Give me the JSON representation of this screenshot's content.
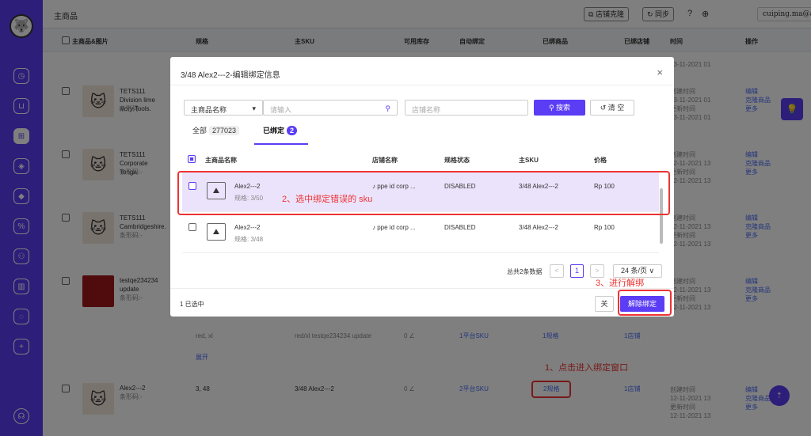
{
  "header": {
    "title": "主商品",
    "clone_label": "店铺克隆",
    "sync_label": "同步",
    "user": "cuiping.ma@a...∨"
  },
  "table": {
    "headers": [
      "主商品&图片",
      "规格",
      "主SKU",
      "可用库存",
      "自动绑定",
      "已绑商品",
      "已绑店铺",
      "时间",
      "操作"
    ],
    "rows": [
      {
        "title": "TETS111 Division lime ivory Tools.",
        "barcode": "条形码:-",
        "t1": "创建时间",
        "d1": "13-11-2021 01",
        "t2": "更新时间",
        "d2": "13-11-2021 01",
        "ops": [
          "编辑",
          "克隆商品",
          "更多"
        ]
      },
      {
        "title": "TETS111 Corporate Tonga",
        "barcode": "条形码:-",
        "t1": "创建时间",
        "d1": "12-11-2021 13",
        "t2": "更新时间",
        "d2": "12-11-2021 13",
        "ops": [
          "编辑",
          "克隆商品",
          "更多"
        ]
      },
      {
        "title": "TETS111 Cambridgeshire.",
        "barcode": "条形码:-",
        "t1": "创建时间",
        "d1": "12-11-2021 13",
        "t2": "更新时间",
        "d2": "12-11-2021 13",
        "ops": [
          "编辑",
          "克隆商品",
          "更多"
        ]
      },
      {
        "title": "testqe234234 update",
        "barcode": "条形码:-",
        "t1": "创建时间",
        "d1": "12-11-2021 13",
        "t2": "更新时间",
        "d2": "12-11-2021 13",
        "ops": [
          "编辑",
          "克隆商品",
          "更多"
        ]
      }
    ],
    "partial_top": {
      "d": "13-11-2021 01"
    },
    "sub_row": {
      "spec": "red, xl",
      "sku": "red/xl testqe234234 update",
      "stock": "0 ∠",
      "platform": "1平台SKU",
      "specs": "1规格",
      "stores": "1店铺"
    },
    "expand": "展开",
    "last_row": {
      "title": "Alex2---2",
      "barcode": "条形码:-",
      "spec": "3, 48",
      "sku": "3/48 Alex2---2",
      "stock": "0 ∠",
      "platform": "2平台SKU",
      "specs": "2规格",
      "stores": "1店铺",
      "t1": "创建时间",
      "d1": "12-11-2021 13",
      "t2": "更新时间",
      "d2": "12-11-2021 13",
      "ops": [
        "编辑",
        "克隆商品",
        "更多"
      ]
    }
  },
  "annotations": {
    "a1": "1、点击进入绑定窗口",
    "a2": "2、选中绑定错误的 sku",
    "a3": "3、进行解绑"
  },
  "modal": {
    "title": "3/48 Alex2---2-编辑绑定信息",
    "close": "×",
    "select_label": "主商品名称",
    "input_placeholder": "请输入",
    "store_placeholder": "店铺名称",
    "search_label": "搜索",
    "clear_label": "清 空",
    "tabs": [
      {
        "label": "全部",
        "count": "277023"
      },
      {
        "label": "已绑定",
        "count": "2"
      }
    ],
    "columns": [
      "主商品名称",
      "店铺名称",
      "规格状态",
      "主SKU",
      "价格"
    ],
    "rows": [
      {
        "name": "Alex2---2",
        "spec": "规格: 3/50",
        "store": "ppe id corp ...",
        "status": "DISABLED",
        "sku": "3/48 Alex2---2",
        "price": "Rp 100",
        "checked": true
      },
      {
        "name": "Alex2---2",
        "spec": "规格: 3/48",
        "store": "ppe id corp ...",
        "status": "DISABLED",
        "sku": "3/48 Alex2---2",
        "price": "Rp 100",
        "checked": false
      }
    ],
    "pagination": {
      "total": "总共2条数据",
      "prev": "<",
      "page": "1",
      "next": ">",
      "page_size": "24 条/页 ∨"
    },
    "footer": {
      "selected": "1 已选中",
      "close_label": "关",
      "unbind_label": "解除绑定"
    }
  },
  "colors": {
    "accent": "#5b3df5",
    "annotation": "#e33333"
  }
}
